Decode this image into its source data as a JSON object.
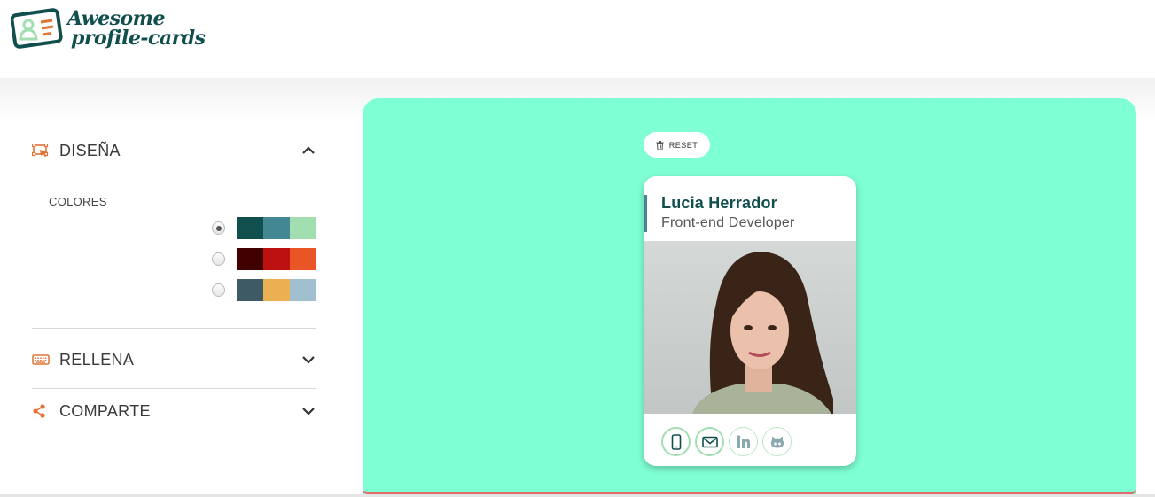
{
  "header": {
    "logo_line1": "Awesome",
    "logo_line2": "profile-cards"
  },
  "sidebar": {
    "sections": [
      {
        "label": "DISEÑA",
        "icon": "design-icon",
        "expanded": true
      },
      {
        "label": "RELLENA",
        "icon": "keyboard-icon",
        "expanded": false
      },
      {
        "label": "COMPARTE",
        "icon": "share-icon",
        "expanded": false
      }
    ],
    "colores_label": "COLORES",
    "palettes": [
      {
        "colors": [
          "#114e4e",
          "#438792",
          "#a2deaf"
        ],
        "selected": true
      },
      {
        "colors": [
          "#420101",
          "#bd1010",
          "#e95626"
        ],
        "selected": false
      },
      {
        "colors": [
          "#3e5b65",
          "#eab052",
          "#a0c0cf"
        ],
        "selected": false
      }
    ]
  },
  "preview": {
    "reset_label": "RESET",
    "card": {
      "name": "Lucia Herrador",
      "job": "Front-end Developer",
      "socials": [
        {
          "icon": "mobile-icon",
          "active": true
        },
        {
          "icon": "email-icon",
          "active": true
        },
        {
          "icon": "linkedin-icon",
          "active": false
        },
        {
          "icon": "github-icon",
          "active": false
        }
      ]
    }
  },
  "colors": {
    "brand_dark": "#114e4e",
    "accent_orange": "#e17334",
    "preview_bg": "#7fffd4"
  }
}
